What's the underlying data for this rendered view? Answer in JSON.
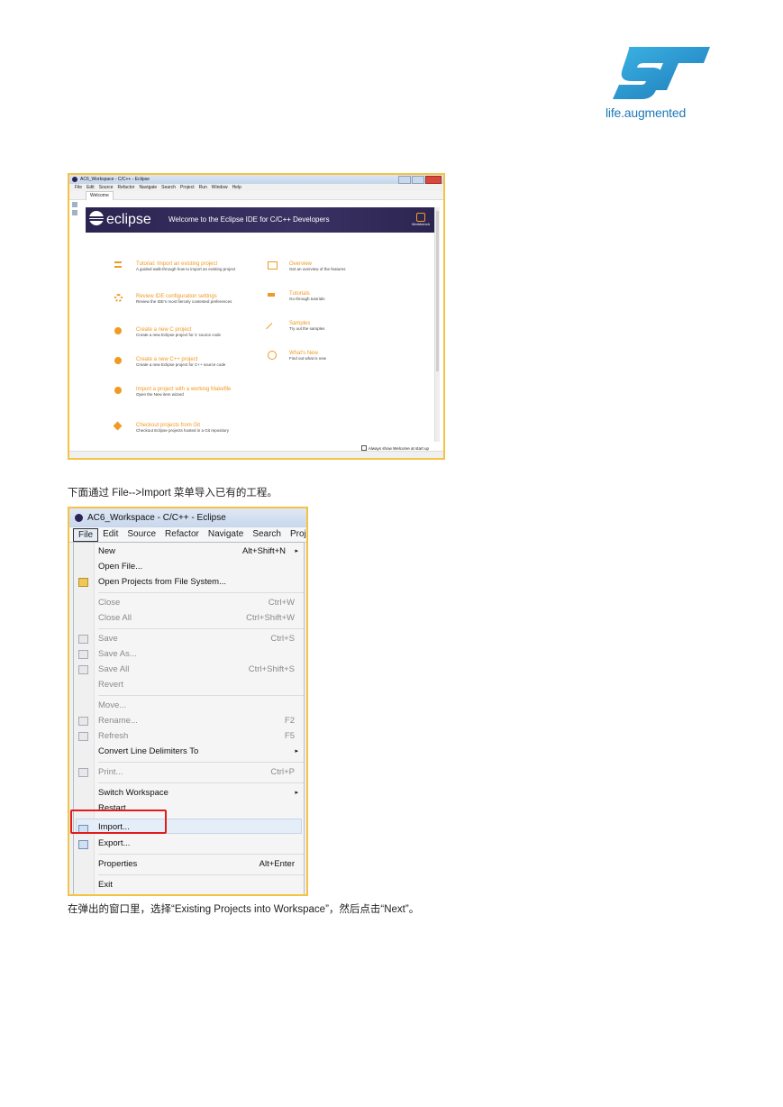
{
  "logo": {
    "tagline": "life.augmented",
    "colors": {
      "primary": "#1d79b8",
      "accent": "#3cb4e5"
    }
  },
  "shot1": {
    "window_title": "AC6_Workspace - C/C++ - Eclipse",
    "menu": [
      "File",
      "Edit",
      "Source",
      "Refactor",
      "Navigate",
      "Search",
      "Project",
      "Run",
      "Window",
      "Help"
    ],
    "tab_label": "Welcome",
    "header_wordmark": "eclipse",
    "header_title": "Welcome to the Eclipse IDE for C/C++ Developers",
    "workbench_label": "Workbench",
    "left_items": [
      {
        "title": "Tutorial: Import an existing project",
        "desc": "A guided walk-through how to import an existing project",
        "icon": "list-icon"
      },
      {
        "title": "Review IDE configuration settings",
        "desc": "Review the IDE's most fiercely contested preferences",
        "icon": "gear-icon"
      },
      {
        "title": "Create a new C project",
        "desc": "Create a new Eclipse project for C source code",
        "icon": "plus-icon"
      },
      {
        "title": "Create a new C++ project",
        "desc": "Create a new Eclipse project for C++ source code",
        "icon": "plus-icon"
      },
      {
        "title": "Import a project with a working Makefile",
        "desc": "Open the New item wizard",
        "icon": "plus-icon"
      },
      {
        "title": "Checkout projects from Git",
        "desc": "Checkout Eclipse projects hosted in a Git repository",
        "icon": "git-icon"
      }
    ],
    "right_items": [
      {
        "title": "Overview",
        "desc": "Get an overview of the features",
        "icon": "map-icon"
      },
      {
        "title": "Tutorials",
        "desc": "Go through tutorials",
        "icon": "grad-cap-icon"
      },
      {
        "title": "Samples",
        "desc": "Try out the samples",
        "icon": "wand-icon"
      },
      {
        "title": "What's New",
        "desc": "Find out what is new",
        "icon": "whats-new-icon"
      }
    ],
    "footer_checkbox": "Always show Welcome at start up"
  },
  "caption1": "下面通过 File-->Import 菜单导入已有的工程。",
  "shot2": {
    "window_title": "AC6_Workspace - C/C++ - Eclipse",
    "menubar": [
      "File",
      "Edit",
      "Source",
      "Refactor",
      "Navigate",
      "Search",
      "Project"
    ],
    "items": [
      {
        "label": "New",
        "accel": "Alt+Shift+N",
        "submenu": "▸"
      },
      {
        "label": "Open File..."
      },
      {
        "label": "Open Projects from File System..."
      },
      {
        "label": "Close",
        "accel": "Ctrl+W"
      },
      {
        "label": "Close All",
        "accel": "Ctrl+Shift+W"
      },
      {
        "label": "Save",
        "accel": "Ctrl+S"
      },
      {
        "label": "Save As..."
      },
      {
        "label": "Save All",
        "accel": "Ctrl+Shift+S"
      },
      {
        "label": "Revert"
      },
      {
        "label": "Move..."
      },
      {
        "label": "Rename...",
        "accel": "F2"
      },
      {
        "label": "Refresh",
        "accel": "F5"
      },
      {
        "label": "Convert Line Delimiters To",
        "submenu": "▸"
      },
      {
        "label": "Print...",
        "accel": "Ctrl+P"
      },
      {
        "label": "Switch Workspace",
        "submenu": "▸"
      },
      {
        "label": "Restart"
      },
      {
        "label": "Import..."
      },
      {
        "label": "Export..."
      },
      {
        "label": "Properties",
        "accel": "Alt+Enter"
      },
      {
        "label": "Exit"
      }
    ],
    "highlight_color": "#e21b1b"
  },
  "caption2": "在弹出的窗口里，选择“Existing Projects into Workspace”，然后点击“Next”。"
}
